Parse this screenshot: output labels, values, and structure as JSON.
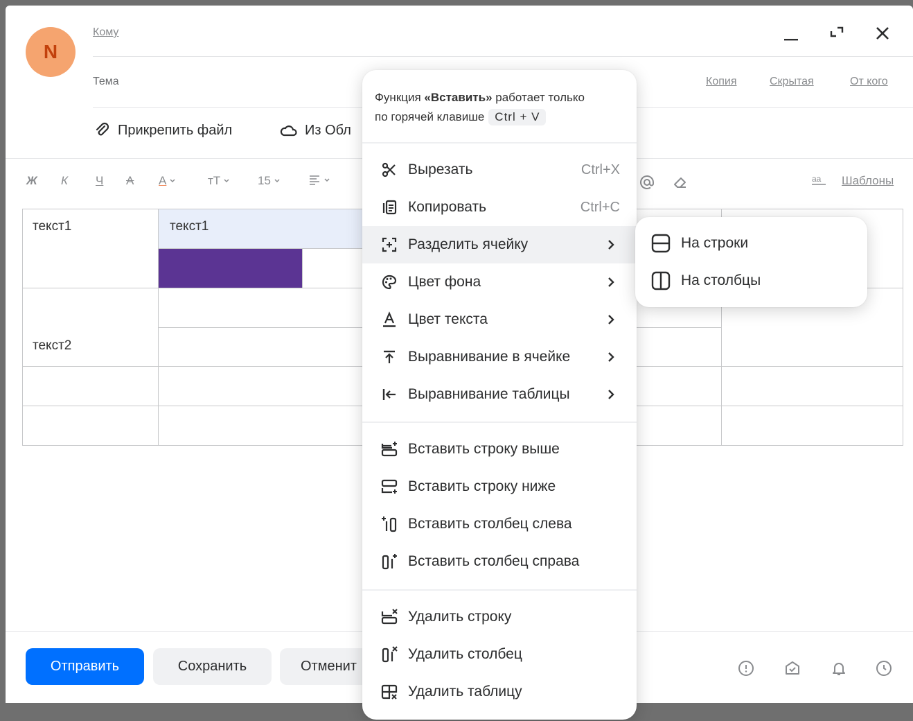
{
  "header": {
    "avatar_letter": "N",
    "to_label": "Кому",
    "subject_label": "Тема",
    "copy_link": "Копия",
    "hidden_link": "Скрытая",
    "from_link": "От кого"
  },
  "attach": {
    "file_label": "Прикрепить файл",
    "cloud_label": "Из Обл"
  },
  "toolbar": {
    "bold": "Ж",
    "italic": "К",
    "underline": "Ч",
    "strike": "А",
    "font_color": "А",
    "font_size_icon": "тT",
    "font_size": "15",
    "templates_label": "Шаблоны"
  },
  "table": {
    "r1c1": "текст1",
    "r1c2": "текст1",
    "r2c1": "текст2",
    "selected_fill": "#e8eefa",
    "purple_fill": "#5b3493"
  },
  "footer": {
    "send": "Отправить",
    "save": "Сохранить",
    "cancel": "Отменит"
  },
  "context_menu": {
    "hint_prefix": "Функция ",
    "hint_bold": "«Вставить»",
    "hint_mid": " работает только",
    "hint_line2": "по горячей клавише",
    "hint_kbd": "Ctrl + V",
    "items": [
      {
        "label": "Вырезать",
        "shortcut": "Ctrl+X",
        "icon": "scissors-icon"
      },
      {
        "label": "Копировать",
        "shortcut": "Ctrl+C",
        "icon": "copy-icon"
      },
      {
        "label": "Разделить ячейку",
        "icon": "split-cell-icon"
      },
      {
        "label": "Цвет фона",
        "icon": "palette-icon"
      },
      {
        "label": "Цвет текста",
        "icon": "text-color-icon"
      },
      {
        "label": "Выравнивание в ячейке",
        "icon": "align-top-icon"
      },
      {
        "label": "Выравнивание таблицы",
        "icon": "align-left-icon"
      },
      {
        "label": "Вставить строку выше",
        "icon": "insert-row-above-icon"
      },
      {
        "label": "Вставить строку ниже",
        "icon": "insert-row-below-icon"
      },
      {
        "label": "Вставить столбец слева",
        "icon": "insert-col-left-icon"
      },
      {
        "label": "Вставить столбец справа",
        "icon": "insert-col-right-icon"
      },
      {
        "label": "Удалить строку",
        "icon": "delete-row-icon"
      },
      {
        "label": "Удалить столбец",
        "icon": "delete-col-icon"
      },
      {
        "label": "Удалить таблицу",
        "icon": "delete-table-icon"
      }
    ]
  },
  "submenu": {
    "items": [
      {
        "label": "На строки",
        "icon": "split-rows-icon"
      },
      {
        "label": "На столбцы",
        "icon": "split-cols-icon"
      }
    ]
  },
  "colors": {
    "primary": "#0070ff",
    "avatar_bg": "#f5a46f",
    "avatar_fg": "#c2410c"
  }
}
